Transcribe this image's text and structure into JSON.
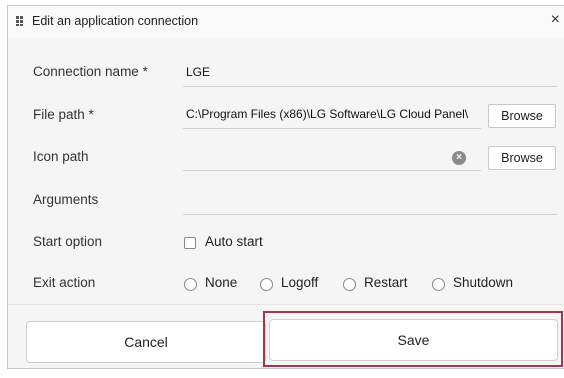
{
  "dialog": {
    "title": "Edit an application connection",
    "close_label": "×"
  },
  "form": {
    "connection_name": {
      "label": "Connection name *",
      "value": "LGE"
    },
    "file_path": {
      "label": "File path *",
      "value": "C:\\Program Files (x86)\\LG Software\\LG Cloud Panel\\",
      "browse_label": "Browse"
    },
    "icon_path": {
      "label": "Icon path",
      "value": "",
      "browse_label": "Browse",
      "clear_icon": "clear-icon"
    },
    "arguments": {
      "label": "Arguments",
      "value": ""
    },
    "start_option": {
      "label": "Start option",
      "checkbox_label": "Auto start",
      "checked": false
    },
    "exit_action": {
      "label": "Exit action",
      "options": [
        "None",
        "Logoff",
        "Restart",
        "Shutdown"
      ],
      "selected": null
    }
  },
  "footer": {
    "cancel_label": "Cancel",
    "save_label": "Save",
    "highlight_color": "#a8344a"
  }
}
